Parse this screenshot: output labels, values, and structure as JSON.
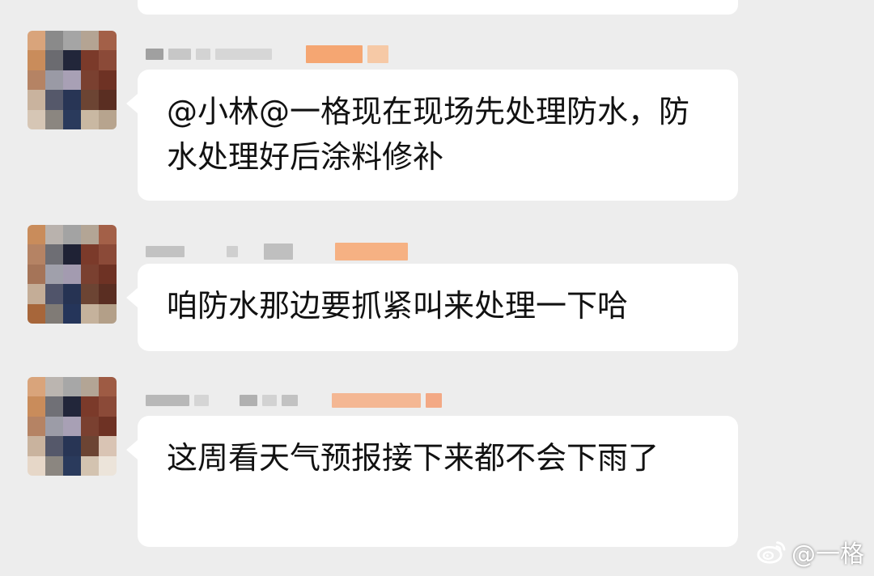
{
  "messages": [
    {
      "text": "@小林@一格现在现场先处理防水，防水处理好后涂料修补"
    },
    {
      "text": "咱防水那边要抓紧叫来处理一下哈"
    },
    {
      "text": "这周看天气预报接下来都不会下雨了"
    }
  ],
  "watermark": {
    "text": "@一格",
    "icon": "weibo-icon"
  },
  "colors": {
    "background": "#ededed",
    "bubble": "#ffffff",
    "text": "#111111",
    "name_accent": "#f0a06a"
  }
}
